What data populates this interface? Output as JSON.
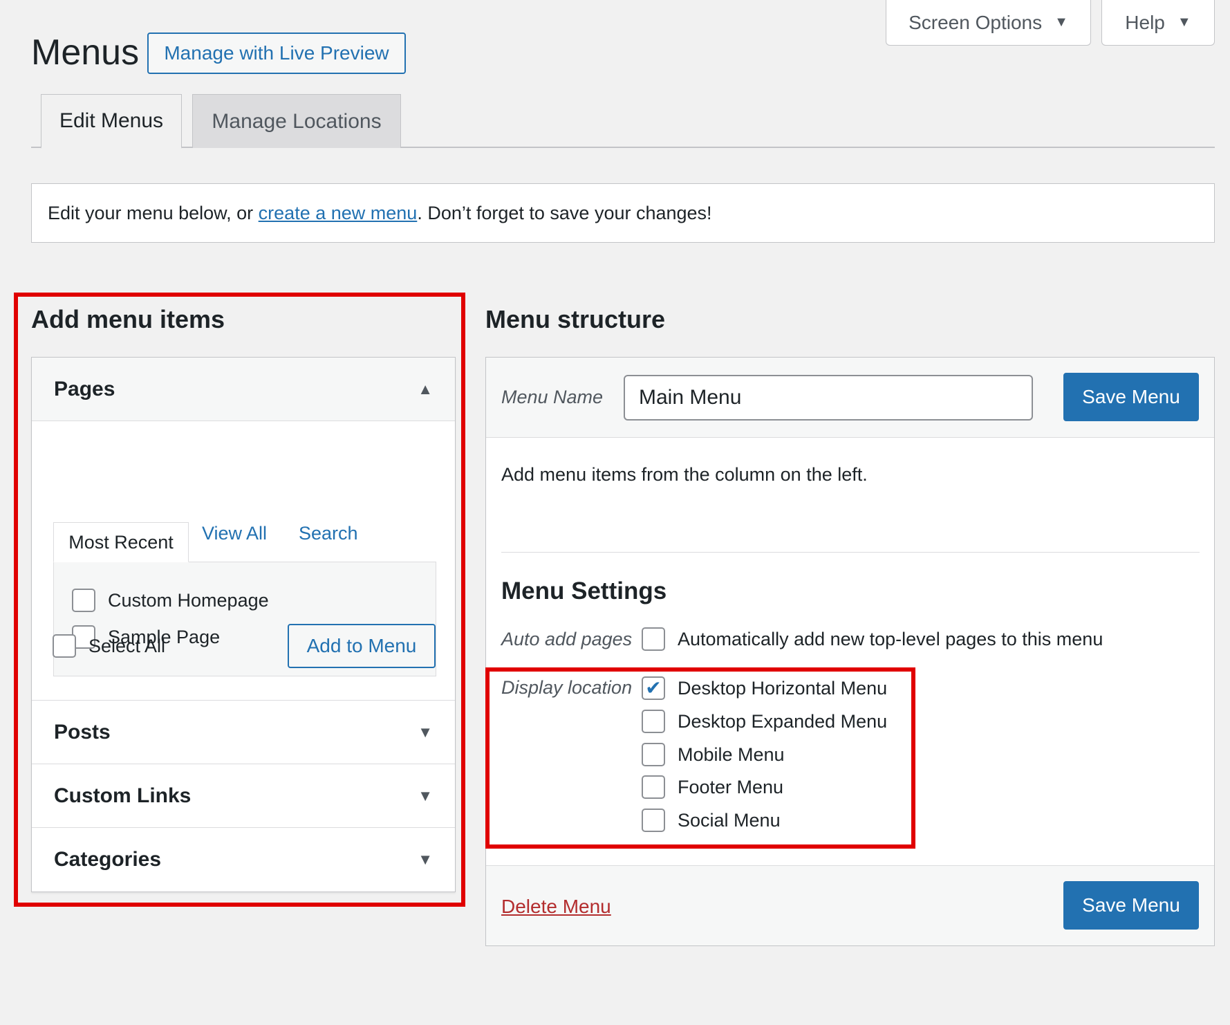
{
  "screen_meta": {
    "screen_options_label": "Screen Options",
    "help_label": "Help"
  },
  "header": {
    "title": "Menus",
    "live_preview_label": "Manage with Live Preview"
  },
  "nav_tabs": [
    {
      "label": "Edit Menus",
      "active": true
    },
    {
      "label": "Manage Locations",
      "active": false
    }
  ],
  "notice": {
    "prefix": "Edit your menu below, or ",
    "link_text": "create a new menu",
    "suffix": ". Don’t forget to save your changes!"
  },
  "add_items": {
    "heading": "Add menu items",
    "pages": {
      "title": "Pages",
      "tabs": [
        "Most Recent",
        "View All",
        "Search"
      ],
      "items": [
        {
          "label": "Custom Homepage",
          "checked": false
        },
        {
          "label": "Sample Page",
          "checked": false
        }
      ],
      "select_all_label": "Select All",
      "add_button_label": "Add to Menu"
    },
    "sections": [
      "Posts",
      "Custom Links",
      "Categories"
    ]
  },
  "menu_structure": {
    "heading": "Menu structure",
    "menu_name_label": "Menu Name",
    "menu_name_value": "Main Menu",
    "save_label": "Save Menu",
    "instructions": "Add menu items from the column on the left.",
    "settings_heading": "Menu Settings",
    "auto_add_label": "Auto add pages",
    "auto_add_option": "Automatically add new top-level pages to this menu",
    "display_location_label": "Display location",
    "locations": [
      {
        "label": "Desktop Horizontal Menu",
        "checked": true
      },
      {
        "label": "Desktop Expanded Menu",
        "checked": false
      },
      {
        "label": "Mobile Menu",
        "checked": false
      },
      {
        "label": "Footer Menu",
        "checked": false
      },
      {
        "label": "Social Menu",
        "checked": false
      }
    ],
    "delete_label": "Delete Menu"
  },
  "colors": {
    "accent": "#2271b1",
    "highlight": "#e00000",
    "danger": "#b32d2e"
  }
}
